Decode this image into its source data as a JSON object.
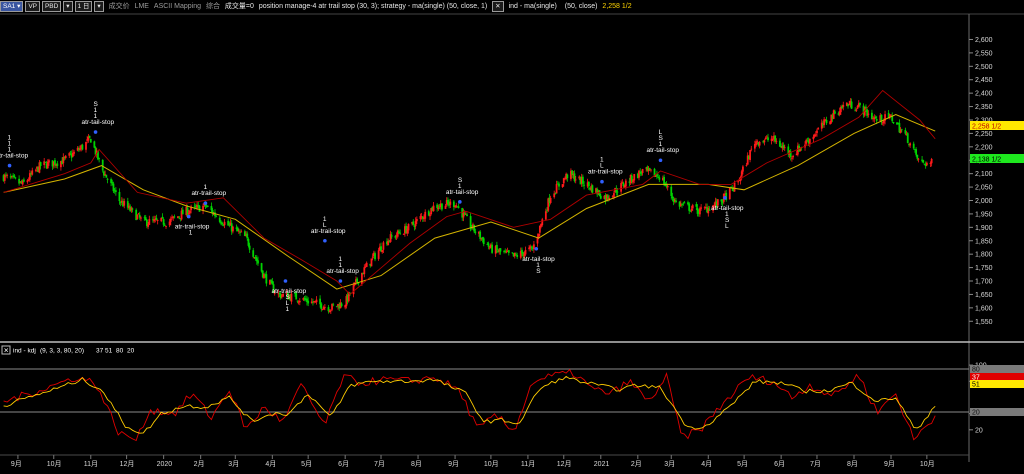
{
  "toolbar": {
    "symbol_label": "SA1",
    "vp_label": "VP",
    "pbd_label": "PBD",
    "tf_label": "1 日",
    "tag_a": "成交价",
    "tag_b": "LME",
    "tag_c": "ASCII Mapping",
    "tag_d": "综合",
    "tag_e": "成交量=0",
    "strategy_text": "position manage-4 atr trail stop (30, 3); strategy - ma(single) (50, close, 1)",
    "ind_text": "ind - ma(single)",
    "ind_params": "(50, close)",
    "ind_value": "2,258 1/2"
  },
  "subpane": {
    "title": "ind - kdj",
    "params": "(9, 3, 3, 80, 20)",
    "k_value": "37",
    "d_value": "51",
    "hi_value": "80",
    "lo_value": "20"
  },
  "right_labels": {
    "ma_value": "2,258 1/2",
    "price_value": "2,138 1/2",
    "k_value": "37",
    "d_value": "51",
    "top_level": "80",
    "bottom_level": "20"
  },
  "colors": {
    "up_candle": "#ff1a1a",
    "down_candle": "#00d400",
    "ma_line": "#d4b400",
    "trail_stop": "#b00000",
    "kdj_k": "#e00000",
    "kdj_d": "#ffcc00",
    "level_band": "#8a8a8a"
  },
  "annotations": [
    {
      "label": "atr-tail-stop",
      "signals": [
        "1",
        "1",
        "1"
      ]
    },
    {
      "label": "atr-tail-stop",
      "signals": [
        "1",
        "1",
        "S"
      ]
    },
    {
      "label": "atr-trail-stop",
      "signals": [
        "1"
      ]
    },
    {
      "label": "atr-trail-stop",
      "signals": [
        "1"
      ]
    },
    {
      "label": "atr-trail-stop",
      "signals": [
        "S",
        "L",
        "1"
      ]
    },
    {
      "label": "atr-tail-stop",
      "signals": [
        "1",
        "1"
      ]
    },
    {
      "label": "atr-trail-stop",
      "signals": [
        "L",
        "1"
      ]
    },
    {
      "label": "atr-tail-stop",
      "signals": [
        "1",
        "S"
      ]
    },
    {
      "label": "atr-tail-stop",
      "signals": [
        "1",
        "S"
      ]
    },
    {
      "label": "atr-trail-stop",
      "signals": [
        "L",
        "1"
      ]
    },
    {
      "label": "atr-tail-stop",
      "signals": [
        "1",
        "S",
        "L"
      ]
    },
    {
      "label": "atr-tail-stop",
      "signals": [
        "1",
        "S",
        "L"
      ]
    }
  ],
  "chart_data": [
    {
      "type": "candlestick",
      "title": "",
      "x_ticks": [
        "9月",
        "10月",
        "11月",
        "12月",
        "2020",
        "2月",
        "3月",
        "4月",
        "5月",
        "6月",
        "7月",
        "8月",
        "9月",
        "10月",
        "11月",
        "12月",
        "2021",
        "2月",
        "3月",
        "4月",
        "5月",
        "6月",
        "7月",
        "8月",
        "9月",
        "10月"
      ],
      "ylim": [
        1510,
        2680
      ],
      "y_ticks": [
        1550,
        1600,
        1650,
        1700,
        1750,
        1800,
        1850,
        1900,
        1950,
        2000,
        2050,
        2100,
        2150,
        2200,
        2250,
        2300,
        2350,
        2400,
        2450,
        2500,
        2550,
        2600
      ],
      "y_tick_labels": [
        "1,550",
        "1,600",
        "1,650",
        "1,700",
        "1,750",
        "1,800",
        "1,850",
        "1,900",
        "1,950",
        "2,000",
        "2,050",
        "2,100",
        "2,150",
        "2,200",
        "2,250",
        "2,300",
        "2,350",
        "2,400",
        "2,450",
        "2,500",
        "2,550",
        "2,600"
      ],
      "close_anchors": [
        {
          "x": "2019-08-20",
          "y": 2090
        },
        {
          "x": "2019-09-05",
          "y": 2060
        },
        {
          "x": "2019-09-20",
          "y": 2130
        },
        {
          "x": "2019-10-10",
          "y": 2150
        },
        {
          "x": "2019-10-25",
          "y": 2200
        },
        {
          "x": "2019-11-01",
          "y": 2230
        },
        {
          "x": "2019-11-10",
          "y": 2120
        },
        {
          "x": "2019-11-25",
          "y": 2000
        },
        {
          "x": "2019-12-15",
          "y": 1920
        },
        {
          "x": "2020-01-05",
          "y": 1920
        },
        {
          "x": "2020-01-20",
          "y": 1960
        },
        {
          "x": "2020-02-05",
          "y": 1980
        },
        {
          "x": "2020-02-20",
          "y": 1920
        },
        {
          "x": "2020-03-10",
          "y": 1860
        },
        {
          "x": "2020-03-25",
          "y": 1720
        },
        {
          "x": "2020-04-05",
          "y": 1650
        },
        {
          "x": "2020-04-20",
          "y": 1640
        },
        {
          "x": "2020-05-05",
          "y": 1620
        },
        {
          "x": "2020-05-20",
          "y": 1600
        },
        {
          "x": "2020-06-01",
          "y": 1620
        },
        {
          "x": "2020-06-15",
          "y": 1730
        },
        {
          "x": "2020-07-05",
          "y": 1850
        },
        {
          "x": "2020-07-25",
          "y": 1900
        },
        {
          "x": "2020-08-15",
          "y": 1980
        },
        {
          "x": "2020-09-01",
          "y": 1990
        },
        {
          "x": "2020-09-15",
          "y": 1900
        },
        {
          "x": "2020-10-01",
          "y": 1820
        },
        {
          "x": "2020-10-20",
          "y": 1790
        },
        {
          "x": "2020-11-05",
          "y": 1820
        },
        {
          "x": "2020-11-20",
          "y": 2020
        },
        {
          "x": "2020-12-05",
          "y": 2100
        },
        {
          "x": "2020-12-20",
          "y": 2060
        },
        {
          "x": "2021-01-05",
          "y": 2010
        },
        {
          "x": "2021-01-20",
          "y": 2060
        },
        {
          "x": "2021-02-05",
          "y": 2110
        },
        {
          "x": "2021-02-20",
          "y": 2090
        },
        {
          "x": "2021-03-05",
          "y": 1990
        },
        {
          "x": "2021-03-25",
          "y": 1960
        },
        {
          "x": "2021-04-10",
          "y": 1990
        },
        {
          "x": "2021-04-25",
          "y": 2060
        },
        {
          "x": "2021-05-10",
          "y": 2220
        },
        {
          "x": "2021-05-25",
          "y": 2230
        },
        {
          "x": "2021-06-10",
          "y": 2170
        },
        {
          "x": "2021-06-25",
          "y": 2230
        },
        {
          "x": "2021-07-10",
          "y": 2300
        },
        {
          "x": "2021-07-25",
          "y": 2360
        },
        {
          "x": "2021-08-05",
          "y": 2350
        },
        {
          "x": "2021-08-20",
          "y": 2300
        },
        {
          "x": "2021-09-01",
          "y": 2310
        },
        {
          "x": "2021-09-15",
          "y": 2230
        },
        {
          "x": "2021-09-25",
          "y": 2140
        },
        {
          "x": "2021-10-05",
          "y": 2138.5
        }
      ],
      "series": [
        {
          "name": "ma(single) (50, close)",
          "last_value": 2258.5,
          "points": [
            {
              "x": "2019-08-20",
              "y": 2030
            },
            {
              "x": "2019-10-10",
              "y": 2080
            },
            {
              "x": "2019-11-10",
              "y": 2130
            },
            {
              "x": "2019-12-15",
              "y": 2040
            },
            {
              "x": "2020-01-20",
              "y": 1980
            },
            {
              "x": "2020-03-01",
              "y": 1930
            },
            {
              "x": "2020-04-15",
              "y": 1790
            },
            {
              "x": "2020-05-25",
              "y": 1670
            },
            {
              "x": "2020-07-01",
              "y": 1720
            },
            {
              "x": "2020-08-15",
              "y": 1860
            },
            {
              "x": "2020-10-01",
              "y": 1920
            },
            {
              "x": "2020-11-10",
              "y": 1860
            },
            {
              "x": "2020-12-20",
              "y": 1970
            },
            {
              "x": "2021-02-10",
              "y": 2060
            },
            {
              "x": "2021-04-01",
              "y": 2060
            },
            {
              "x": "2021-05-01",
              "y": 2040
            },
            {
              "x": "2021-06-15",
              "y": 2130
            },
            {
              "x": "2021-08-01",
              "y": 2250
            },
            {
              "x": "2021-09-05",
              "y": 2320
            },
            {
              "x": "2021-10-08",
              "y": 2258.5
            }
          ]
        },
        {
          "name": "atr trail stop",
          "points": [
            {
              "x": "2019-08-20",
              "y": 2030
            },
            {
              "x": "2019-10-10",
              "y": 2100
            },
            {
              "x": "2019-11-01",
              "y": 2140
            },
            {
              "x": "2019-11-08",
              "y": 2190
            },
            {
              "x": "2019-12-10",
              "y": 2030
            },
            {
              "x": "2020-01-20",
              "y": 1990
            },
            {
              "x": "2020-02-20",
              "y": 2010
            },
            {
              "x": "2020-03-25",
              "y": 1860
            },
            {
              "x": "2020-04-25",
              "y": 1780
            },
            {
              "x": "2020-05-25",
              "y": 1700
            },
            {
              "x": "2020-06-05",
              "y": 1650
            },
            {
              "x": "2020-07-25",
              "y": 1840
            },
            {
              "x": "2020-08-25",
              "y": 1940
            },
            {
              "x": "2020-09-10",
              "y": 1960
            },
            {
              "x": "2020-10-20",
              "y": 1900
            },
            {
              "x": "2020-11-20",
              "y": 1930
            },
            {
              "x": "2020-12-20",
              "y": 2020
            },
            {
              "x": "2021-02-05",
              "y": 2060
            },
            {
              "x": "2021-02-20",
              "y": 2110
            },
            {
              "x": "2021-03-25",
              "y": 2060
            },
            {
              "x": "2021-04-20",
              "y": 2060
            },
            {
              "x": "2021-05-20",
              "y": 2140
            },
            {
              "x": "2021-07-05",
              "y": 2230
            },
            {
              "x": "2021-08-05",
              "y": 2310
            },
            {
              "x": "2021-08-25",
              "y": 2410
            },
            {
              "x": "2021-09-25",
              "y": 2300
            },
            {
              "x": "2021-10-08",
              "y": 2230
            }
          ]
        }
      ],
      "right_labels": [
        {
          "name": "ma",
          "value": 2258.5
        },
        {
          "name": "last price",
          "value": 2138.5
        }
      ],
      "grid": false,
      "legend": "top-left"
    },
    {
      "type": "line",
      "title": "ind - kdj",
      "ylim": [
        0,
        110
      ],
      "y_ticks": [
        20,
        40,
        80,
        100
      ],
      "levels": [
        80,
        20
      ],
      "series": [
        {
          "name": "K",
          "last_value": 37,
          "points": [
            {
              "x": "2019-08-20",
              "y": 55
            },
            {
              "x": "2019-09-05",
              "y": 62
            },
            {
              "x": "2019-09-25",
              "y": 72
            },
            {
              "x": "2019-10-20",
              "y": 85
            },
            {
              "x": "2019-11-05",
              "y": 78
            },
            {
              "x": "2019-11-25",
              "y": 15
            },
            {
              "x": "2019-12-10",
              "y": 8
            },
            {
              "x": "2019-12-20",
              "y": 45
            },
            {
              "x": "2020-01-10",
              "y": 40
            },
            {
              "x": "2020-01-25",
              "y": 65
            },
            {
              "x": "2020-02-10",
              "y": 35
            },
            {
              "x": "2020-02-25",
              "y": 70
            },
            {
              "x": "2020-03-10",
              "y": 20
            },
            {
              "x": "2020-03-25",
              "y": 48
            },
            {
              "x": "2020-04-10",
              "y": 30
            },
            {
              "x": "2020-04-25",
              "y": 75
            },
            {
              "x": "2020-05-15",
              "y": 25
            },
            {
              "x": "2020-05-30",
              "y": 85
            },
            {
              "x": "2020-06-15",
              "y": 78
            },
            {
              "x": "2020-07-05",
              "y": 82
            },
            {
              "x": "2020-07-25",
              "y": 80
            },
            {
              "x": "2020-08-15",
              "y": 85
            },
            {
              "x": "2020-09-05",
              "y": 68
            },
            {
              "x": "2020-09-20",
              "y": 20
            },
            {
              "x": "2020-10-05",
              "y": 38
            },
            {
              "x": "2020-10-20",
              "y": 18
            },
            {
              "x": "2020-11-05",
              "y": 80
            },
            {
              "x": "2020-11-25",
              "y": 88
            },
            {
              "x": "2020-12-10",
              "y": 90
            },
            {
              "x": "2020-12-25",
              "y": 70
            },
            {
              "x": "2021-01-10",
              "y": 65
            },
            {
              "x": "2021-01-25",
              "y": 80
            },
            {
              "x": "2021-02-10",
              "y": 55
            },
            {
              "x": "2021-02-25",
              "y": 85
            },
            {
              "x": "2021-03-10",
              "y": 10
            },
            {
              "x": "2021-03-25",
              "y": 20
            },
            {
              "x": "2021-04-15",
              "y": 55
            },
            {
              "x": "2021-05-05",
              "y": 85
            },
            {
              "x": "2021-05-25",
              "y": 80
            },
            {
              "x": "2021-06-10",
              "y": 60
            },
            {
              "x": "2021-06-25",
              "y": 75
            },
            {
              "x": "2021-07-15",
              "y": 62
            },
            {
              "x": "2021-08-05",
              "y": 88
            },
            {
              "x": "2021-08-20",
              "y": 42
            },
            {
              "x": "2021-09-05",
              "y": 65
            },
            {
              "x": "2021-09-20",
              "y": 8
            },
            {
              "x": "2021-10-08",
              "y": 37
            }
          ]
        },
        {
          "name": "D",
          "last_value": 51,
          "points": [
            {
              "x": "2019-08-20",
              "y": 50
            },
            {
              "x": "2019-09-10",
              "y": 60
            },
            {
              "x": "2019-10-01",
              "y": 70
            },
            {
              "x": "2019-10-25",
              "y": 82
            },
            {
              "x": "2019-11-10",
              "y": 70
            },
            {
              "x": "2019-11-30",
              "y": 25
            },
            {
              "x": "2019-12-15",
              "y": 15
            },
            {
              "x": "2019-12-30",
              "y": 40
            },
            {
              "x": "2020-01-20",
              "y": 50
            },
            {
              "x": "2020-02-05",
              "y": 48
            },
            {
              "x": "2020-02-25",
              "y": 60
            },
            {
              "x": "2020-03-15",
              "y": 30
            },
            {
              "x": "2020-03-30",
              "y": 40
            },
            {
              "x": "2020-04-15",
              "y": 40
            },
            {
              "x": "2020-05-01",
              "y": 65
            },
            {
              "x": "2020-05-20",
              "y": 35
            },
            {
              "x": "2020-06-05",
              "y": 75
            },
            {
              "x": "2020-06-25",
              "y": 80
            },
            {
              "x": "2020-07-20",
              "y": 80
            },
            {
              "x": "2020-08-15",
              "y": 82
            },
            {
              "x": "2020-09-10",
              "y": 65
            },
            {
              "x": "2020-09-25",
              "y": 30
            },
            {
              "x": "2020-10-10",
              "y": 32
            },
            {
              "x": "2020-10-25",
              "y": 28
            },
            {
              "x": "2020-11-10",
              "y": 70
            },
            {
              "x": "2020-12-01",
              "y": 85
            },
            {
              "x": "2020-12-20",
              "y": 78
            },
            {
              "x": "2021-01-15",
              "y": 70
            },
            {
              "x": "2021-02-01",
              "y": 75
            },
            {
              "x": "2021-02-20",
              "y": 72
            },
            {
              "x": "2021-03-15",
              "y": 22
            },
            {
              "x": "2021-03-30",
              "y": 25
            },
            {
              "x": "2021-04-20",
              "y": 50
            },
            {
              "x": "2021-05-10",
              "y": 80
            },
            {
              "x": "2021-06-01",
              "y": 78
            },
            {
              "x": "2021-06-20",
              "y": 68
            },
            {
              "x": "2021-07-10",
              "y": 68
            },
            {
              "x": "2021-07-30",
              "y": 78
            },
            {
              "x": "2021-08-20",
              "y": 55
            },
            {
              "x": "2021-09-05",
              "y": 60
            },
            {
              "x": "2021-09-22",
              "y": 18
            },
            {
              "x": "2021-10-08",
              "y": 51
            }
          ]
        }
      ],
      "right_labels": [
        {
          "name": "D",
          "value": 51
        },
        {
          "name": "K",
          "value": 37
        },
        {
          "name": "80",
          "value": 80
        },
        {
          "name": "20",
          "value": 20
        }
      ],
      "grid": false,
      "legend": "top-left"
    }
  ]
}
